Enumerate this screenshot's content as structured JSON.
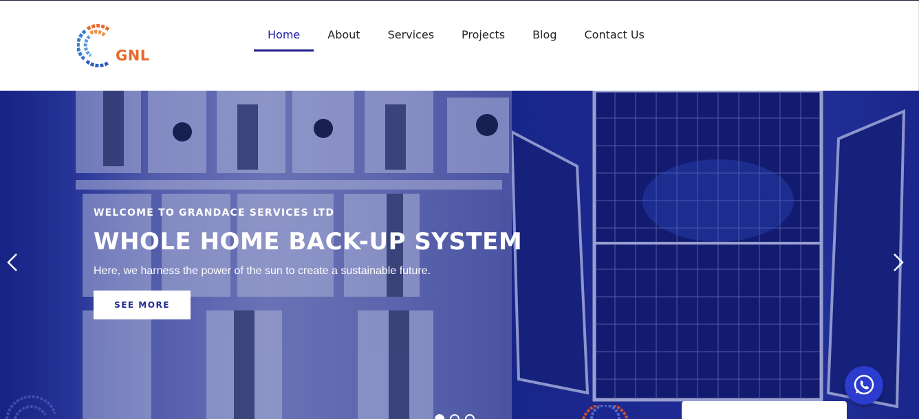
{
  "brand": {
    "name": "GNL",
    "accent_color": "#e8692a",
    "primary_color": "#1a1aa8"
  },
  "nav": {
    "items": [
      {
        "label": "Home",
        "active": true
      },
      {
        "label": "About",
        "active": false
      },
      {
        "label": "Services",
        "active": false
      },
      {
        "label": "Projects",
        "active": false
      },
      {
        "label": "Blog",
        "active": false
      },
      {
        "label": "Contact Us",
        "active": false
      }
    ]
  },
  "hero": {
    "eyebrow": "WELCOME TO GRANDACE SERVICES LTD",
    "title": "WHOLE HOME BACK-UP SYSTEM",
    "subtitle": "Here, we harness the power of the sun to create a sustainable future.",
    "button_label": "SEE MORE",
    "slides_count": 3,
    "active_slide": 1,
    "icons": {
      "prev": "chevron-left-icon",
      "next": "chevron-right-icon",
      "chat": "whatsapp-icon"
    }
  }
}
